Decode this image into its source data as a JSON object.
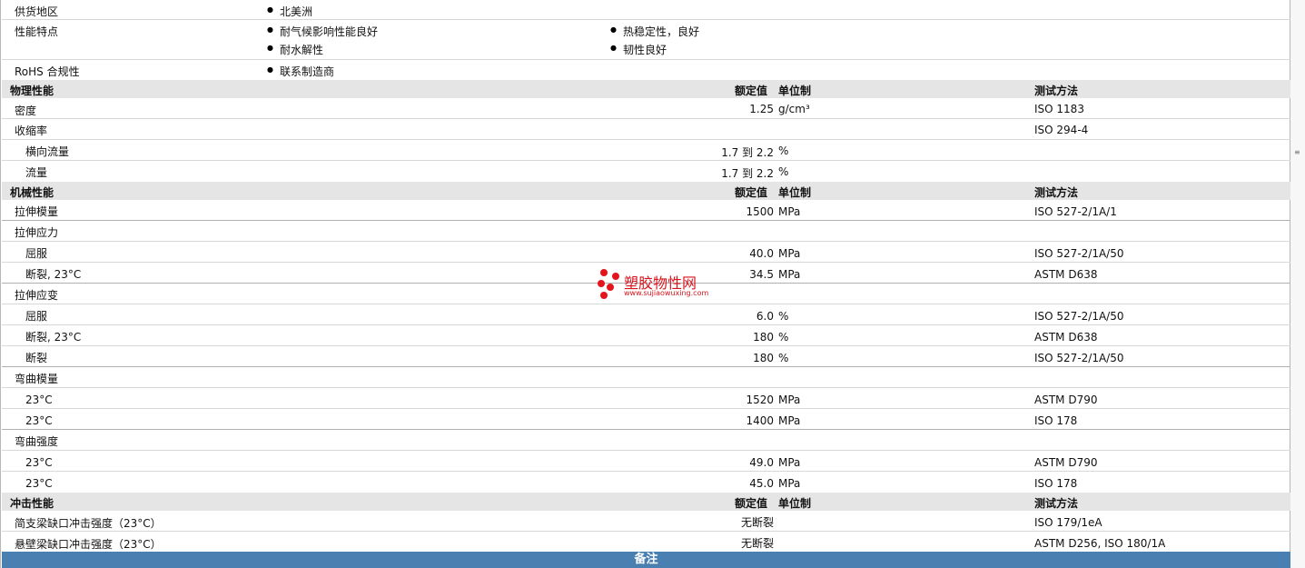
{
  "info": {
    "supply_label": "供货地区",
    "supply_value": "北美洲",
    "features_label": "性能特点",
    "features": [
      "耐气候影响性能良好",
      "热稳定性，良好",
      "耐水解性",
      "韧性良好"
    ],
    "rohs_label": "RoHS 合规性",
    "rohs_value": "联系制造商"
  },
  "headers": {
    "rated": "额定值",
    "unit": "单位制",
    "method": "测试方法"
  },
  "physical": {
    "title": "物理性能",
    "density": {
      "label": "密度",
      "value": "1.25",
      "unit": "g/cm³",
      "method": "ISO 1183"
    },
    "shrink": {
      "label": "收缩率",
      "method": "ISO 294-4"
    },
    "shrink_cross": {
      "label": "横向流量",
      "value": "1.7 到  2.2",
      "unit": "%"
    },
    "shrink_flow": {
      "label": "流量",
      "value": "1.7 到  2.2",
      "unit": "%"
    }
  },
  "mechanical": {
    "title": "机械性能",
    "tensile_modulus": {
      "label": "拉伸模量",
      "value": "1500",
      "unit": "MPa",
      "method": "ISO 527-2/1A/1"
    },
    "tensile_stress": {
      "label": "拉伸应力"
    },
    "ts_yield": {
      "label": "屈服",
      "value": "40.0",
      "unit": "MPa",
      "method": "ISO 527-2/1A/50"
    },
    "ts_break": {
      "label": "断裂, 23°C",
      "value": "34.5",
      "unit": "MPa",
      "method": "ASTM D638"
    },
    "tensile_strain": {
      "label": "拉伸应变"
    },
    "tst_yield": {
      "label": "屈服",
      "value": "6.0",
      "unit": "%",
      "method": "ISO 527-2/1A/50"
    },
    "tst_break23": {
      "label": "断裂, 23°C",
      "value": "180",
      "unit": "%",
      "method": "ASTM D638"
    },
    "tst_break": {
      "label": "断裂",
      "value": "180",
      "unit": "%",
      "method": "ISO 527-2/1A/50"
    },
    "flex_modulus": {
      "label": "弯曲模量"
    },
    "fm_1": {
      "label": "23°C",
      "value": "1520",
      "unit": "MPa",
      "method": "ASTM D790"
    },
    "fm_2": {
      "label": "23°C",
      "value": "1400",
      "unit": "MPa",
      "method": "ISO 178"
    },
    "flex_strength": {
      "label": "弯曲强度"
    },
    "fs_1": {
      "label": "23°C",
      "value": "49.0",
      "unit": "MPa",
      "method": "ASTM D790"
    },
    "fs_2": {
      "label": "23°C",
      "value": "45.0",
      "unit": "MPa",
      "method": "ISO 178"
    }
  },
  "impact": {
    "title": "冲击性能",
    "charpy": {
      "label": "简支梁缺口冲击强度（23°C）",
      "value": "无断裂",
      "method": "ISO 179/1eA"
    },
    "izod": {
      "label": "悬壁梁缺口冲击强度（23°C）",
      "value": "无断裂",
      "method": "ASTM D256, ISO 180/1A"
    }
  },
  "footer": {
    "title": "备注"
  },
  "watermark": {
    "text": "塑胶物性网",
    "url": "www.sujiaowuxing.com"
  }
}
